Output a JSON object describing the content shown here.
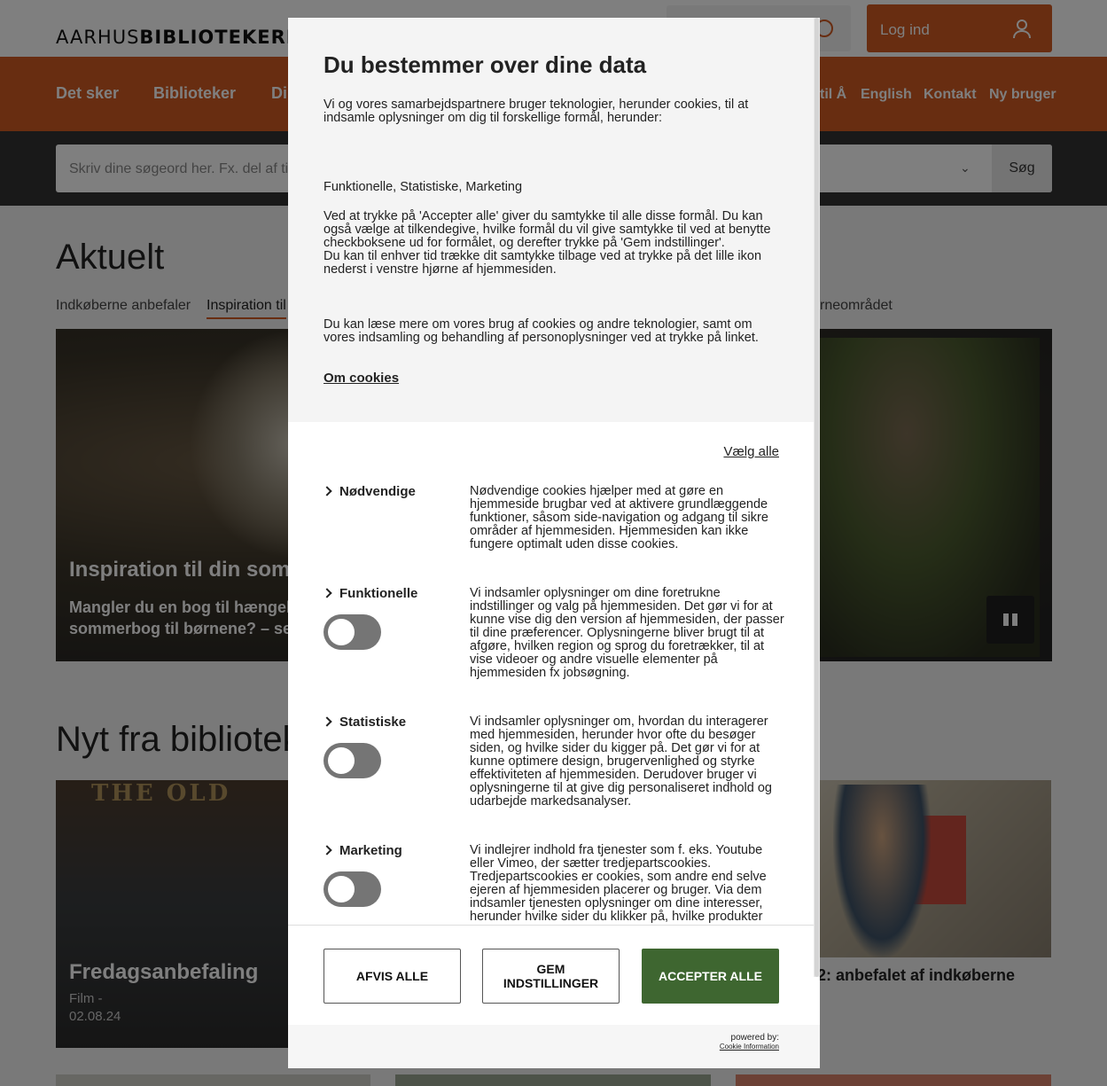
{
  "site": {
    "logo_light": "AARHUS",
    "logo_bold": "BIBLIOTEKERNE",
    "login": "Log ind",
    "nav": [
      "Det sker",
      "Biblioteker",
      "Di"
    ],
    "nav_right": [
      "til Å",
      "English",
      "Kontakt",
      "Ny bruger"
    ],
    "search_placeholder": "Skriv dine søgeord her. Fx. del af tit",
    "search_button": "Søg",
    "section_aktuelt": "Aktuelt",
    "tabs": [
      "Indkøberne anbefaler",
      "Inspiration til",
      "rneområdet"
    ],
    "hero_title": "Inspiration til din somm",
    "hero_sub1": "Mangler du en bog til hængek",
    "hero_sub2": "sommerbog til børnene? – se",
    "section_nyt": "Nyt fra bibliotek",
    "card1_sign": "THE OLD",
    "card1_title": "Fredagsanbefaling",
    "card1_meta1": "Film -",
    "card1_meta2": "02.08.24",
    "card3_title": "er 2: anbefalet af indkøberne"
  },
  "consent": {
    "title": "Du bestemmer over dine data",
    "intro": "Vi og vores samarbejdspartnere bruger teknologier, herunder cookies, til at indsamle oplysninger om dig til forskellige formål, herunder:",
    "purposes": "Funktionelle, Statistiske, Marketing",
    "explain1": "Ved at trykke på 'Accepter alle' giver du samtykke til alle disse formål. Du kan også vælge at tilkendegive, hvilke formål du vil give samtykke til ved at benytte checkboksene ud for formålet, og derefter trykke på 'Gem indstillinger'.",
    "explain2": "Du kan til enhver tid trække dit samtykke tilbage ved at trykke på det lille ikon nederst i venstre hjørne af hjemmesiden.",
    "more": "Du kan læse mere om vores brug af cookies og andre teknologier, samt om vores indsamling og behandling af personoplysninger ved at trykke på linket.",
    "link": "Om cookies",
    "select_all": "Vælg alle",
    "categories": [
      {
        "name": "Nødvendige",
        "desc": "Nødvendige cookies hjælper med at gøre en hjemmeside brugbar ved at aktivere grundlæggende funktioner, såsom side-navigation og adgang til sikre områder af hjemmesiden. Hjemmesiden kan ikke fungere optimalt uden disse cookies."
      },
      {
        "name": "Funktionelle",
        "desc": "Vi indsamler oplysninger om dine foretrukne indstillinger og valg på hjemmesiden. Det gør vi for at kunne vise dig den version af hjemmesiden, der passer til dine præferencer. Oplysningerne bliver brugt til at afgøre, hvilken region og sprog du foretrækker, til at vise videoer og andre visuelle elementer på hjemmesiden fx jobsøgning."
      },
      {
        "name": "Statistiske",
        "desc": "Vi indsamler oplysninger om, hvordan du interagerer med hjemmesiden, herunder hvor ofte du besøger siden, og hvilke sider du kigger på. Det gør vi for at kunne optimere design, brugervenlighed og styrke effektiviteten af hjemmesiden. Derudover bruger vi oplysningerne til at give dig personaliseret indhold og udarbejde markedsanalyser."
      },
      {
        "name": "Marketing",
        "desc": "Vi indlejrer indhold fra tjenester som f. eks. Youtube eller Vimeo, der sætter tredjepartscookies. Tredjepartscookies er cookies, som andre end selve ejeren af hjemmesiden placerer og bruger. Via dem indsamler tjenesten oplysninger om dine interesser, herunder hvilke sider du klikker på, hvilke produkter"
      }
    ],
    "btn_reject": "AFVIS ALLE",
    "btn_save": "GEM INDSTILLINGER",
    "btn_accept": "ACCEPTER ALLE",
    "powered_by": "powered by:",
    "provider": "Cookie Information"
  }
}
